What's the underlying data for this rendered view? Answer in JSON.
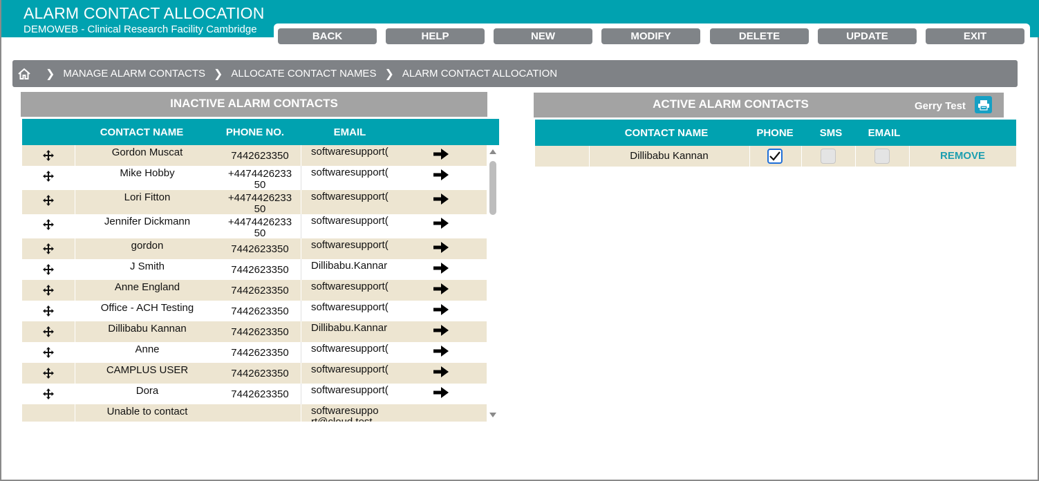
{
  "app": {
    "title": "ALARM CONTACT ALLOCATION",
    "subtitle": "DEMOWEB - Clinical Research Facility Cambridge"
  },
  "toolbar": {
    "back": "BACK",
    "help": "HELP",
    "new": "NEW",
    "modify": "MODIFY",
    "delete": "DELETE",
    "update": "UPDATE",
    "exit": "EXIT"
  },
  "breadcrumb": {
    "home_icon": "home-icon",
    "items": [
      "MANAGE ALARM CONTACTS",
      "ALLOCATE CONTACT NAMES",
      "ALARM CONTACT ALLOCATION"
    ]
  },
  "inactive": {
    "title": "INACTIVE ALARM CONTACTS",
    "columns": {
      "name": "CONTACT NAME",
      "phone": "PHONE NO.",
      "email": "EMAIL"
    },
    "rows": [
      {
        "name": "Gordon Muscat",
        "phone": "7442623350",
        "email": "softwaresupport("
      },
      {
        "name": "Mike Hobby",
        "phone": "+4474426233\n50",
        "email": "softwaresupport("
      },
      {
        "name": "Lori Fitton",
        "phone": "+4474426233\n50",
        "email": "softwaresupport("
      },
      {
        "name": "Jennifer Dickmann",
        "phone": "+4474426233\n50",
        "email": "softwaresupport("
      },
      {
        "name": "gordon",
        "phone": "7442623350",
        "email": "softwaresupport("
      },
      {
        "name": "J Smith",
        "phone": "7442623350",
        "email": "Dillibabu.Kannar"
      },
      {
        "name": "Anne England",
        "phone": "7442623350",
        "email": "softwaresupport("
      },
      {
        "name": "Office - ACH Testing",
        "phone": "7442623350",
        "email": "softwaresupport("
      },
      {
        "name": "Dillibabu Kannan",
        "phone": "7442623350",
        "email": "Dillibabu.Kannar"
      },
      {
        "name": "Anne",
        "phone": "7442623350",
        "email": "softwaresupport("
      },
      {
        "name": "CAMPLUS USER",
        "phone": "7442623350",
        "email": "softwaresupport("
      },
      {
        "name": "Dora",
        "phone": "7442623350",
        "email": "softwaresupport("
      },
      {
        "name": "Unable to contact",
        "phone": "",
        "email": "softwaresuppo\nrt@cloud.test"
      }
    ]
  },
  "active": {
    "title": "ACTIVE ALARM CONTACTS",
    "user": "Gerry Test",
    "columns": {
      "name": "CONTACT NAME",
      "phone": "PHONE",
      "sms": "SMS",
      "email": "EMAIL"
    },
    "rows": [
      {
        "name": "Dillibabu Kannan",
        "phone": true,
        "sms": false,
        "email": false,
        "action": "REMOVE"
      }
    ]
  },
  "colors": {
    "teal": "#00a2b0",
    "button_grey": "#808488",
    "row_beige": "#ede5d1",
    "link": "#1b9eb0"
  }
}
